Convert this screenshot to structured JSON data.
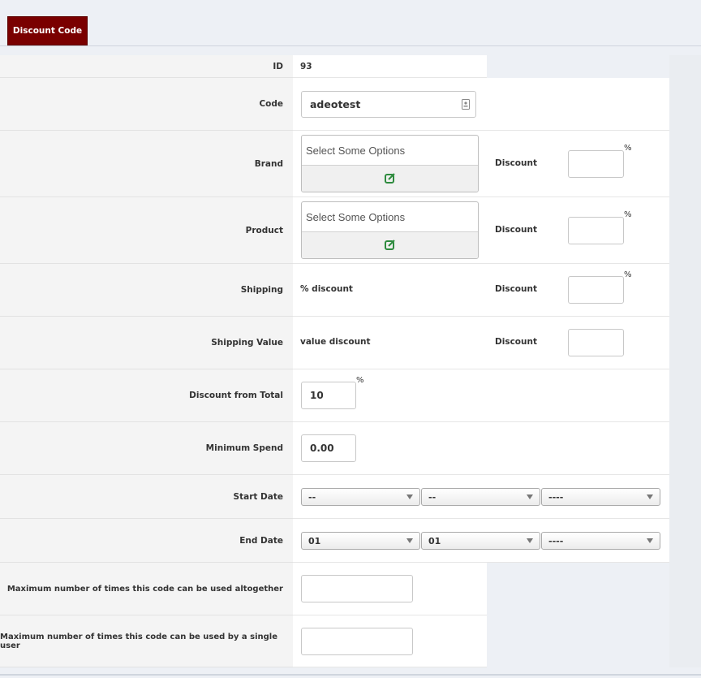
{
  "tab": {
    "label": "Discount Code"
  },
  "id": {
    "label": "ID",
    "value": "93"
  },
  "code": {
    "label": "Code",
    "value": "adeotest"
  },
  "brand": {
    "label": "Brand",
    "placeholder": "Select Some Options",
    "discount_label": "Discount",
    "percent": "%"
  },
  "product": {
    "label": "Product",
    "placeholder": "Select Some Options",
    "discount_label": "Discount",
    "percent": "%"
  },
  "shipping": {
    "label": "Shipping",
    "value": "% discount",
    "discount_label": "Discount",
    "percent": "%"
  },
  "shipping_value": {
    "label": "Shipping Value",
    "value": "value discount",
    "discount_label": "Discount"
  },
  "discount_total": {
    "label": "Discount from Total",
    "value": "10",
    "percent": "%"
  },
  "min_spend": {
    "label": "Minimum Spend",
    "value": "0.00"
  },
  "start_date": {
    "label": "Start Date",
    "day": "--",
    "month": "--",
    "year": "----"
  },
  "end_date": {
    "label": "End Date",
    "day": "01",
    "month": "01",
    "year": "----"
  },
  "max_uses": {
    "label": "Maximum number of times this code can be used altogether",
    "value": ""
  },
  "max_uses_user": {
    "label": "Maximum number of times this code can be used by a single user",
    "value": ""
  },
  "colors": {
    "tab_bg": "#7a0000",
    "edit_icon": "#2e8b3e"
  }
}
